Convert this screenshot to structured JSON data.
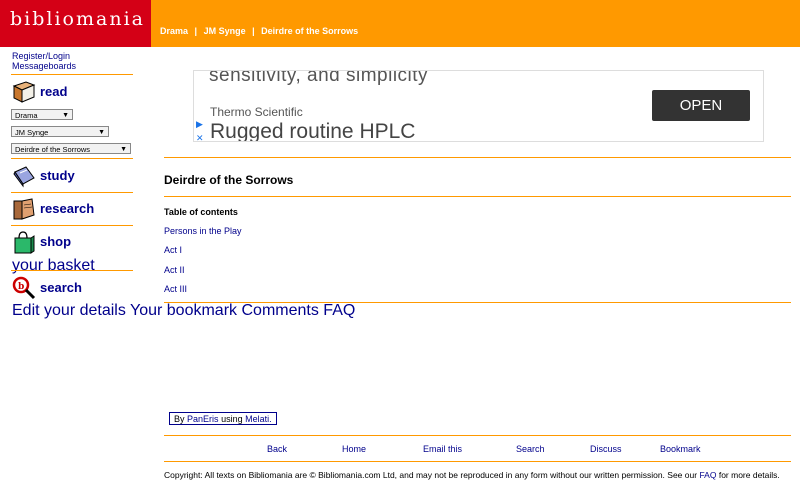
{
  "logo": {
    "text": "bibliomania"
  },
  "breadcrumb": {
    "items": [
      "Drama",
      "JM Synge",
      "Deirdre of the Sorrows"
    ],
    "separator": "|"
  },
  "sidebar": {
    "register_login": "Register/Login",
    "messageboards": "Messageboards",
    "read": {
      "label": "read",
      "icon": "book-icon"
    },
    "selects": [
      {
        "value": "Drama"
      },
      {
        "value": "JM Synge"
      },
      {
        "value": "Deirdre of the Sorrows"
      }
    ],
    "study": {
      "label": "study",
      "icon": "notebook-icon"
    },
    "research": {
      "label": "research",
      "icon": "books-icon"
    },
    "shop": {
      "label": "shop",
      "icon": "shopping-bag-icon"
    },
    "your_basket": "your basket",
    "search": {
      "label": "search",
      "icon": "magnifier-icon"
    },
    "account_links": [
      "Edit your details",
      "Your bookmark",
      "Comments",
      "FAQ"
    ]
  },
  "ad": {
    "top_text": "sensitivity, and simplicity",
    "brand": "Thermo Scientific",
    "headline": "Rugged routine HPLC",
    "cta": "OPEN"
  },
  "main": {
    "title": "Deirdre of the Sorrows",
    "toc_heading": "Table of contents",
    "toc_items": [
      "Persons in the Play",
      "Act I",
      "Act II",
      "Act III"
    ]
  },
  "credit": {
    "by": "By",
    "paneris": "PanEris",
    "using": "using",
    "melati": "Melati."
  },
  "footer": {
    "links": [
      "Back",
      "Home",
      "Email this",
      "Search",
      "Discuss",
      "Bookmark"
    ]
  },
  "copyright": {
    "before": "Copyright: All texts on Bibliomania are © Bibliomania.com Ltd, and may not be reproduced in any form without our written permission. See our",
    "faq": "FAQ",
    "after": "for more details."
  },
  "colors": {
    "brand_red": "#d40016",
    "brand_orange": "#ff9900",
    "link": "#00008b"
  }
}
